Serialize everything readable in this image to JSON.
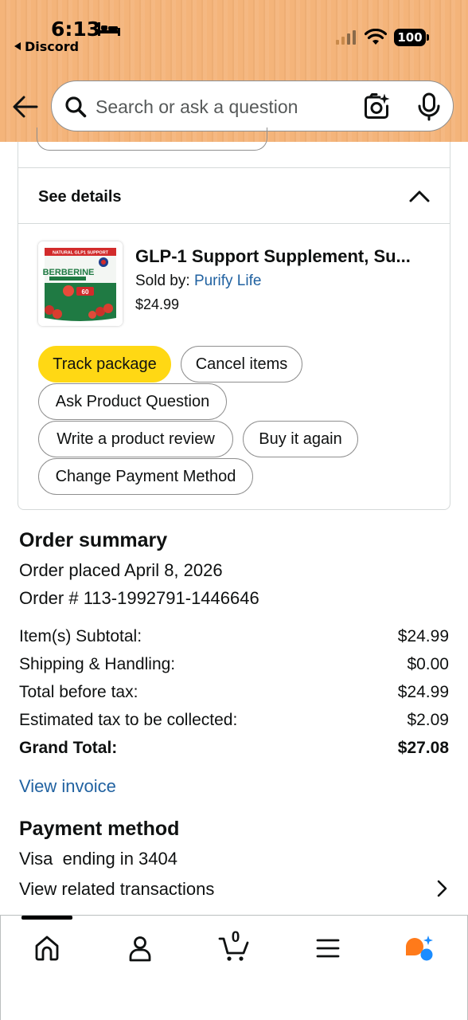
{
  "status_bar": {
    "time": "6:13",
    "back_app": "Discord",
    "battery": "100"
  },
  "search": {
    "placeholder": "Search or ask a question"
  },
  "colors": {
    "header_bg": "#f4b47a",
    "link": "#2162a1",
    "primary_button": "#ffd814",
    "ai_orange": "#ff7a1a",
    "ai_blue": "#1b8cff"
  },
  "details": {
    "label": "See details"
  },
  "product": {
    "title": "GLP-1 Support Supplement, Su...",
    "sold_by_label": "Sold by:",
    "seller": "Purify Life",
    "price": "$24.99",
    "image_text": {
      "top_banner": "NATURAL GLP1 SUPPORT",
      "brand": "BERBERINE",
      "count": "60"
    }
  },
  "actions": {
    "track": "Track package",
    "cancel": "Cancel items",
    "ask": "Ask Product Question",
    "review": "Write a product review",
    "buy_again": "Buy it again",
    "change_payment": "Change Payment Method"
  },
  "summary": {
    "heading": "Order summary",
    "placed": "Order placed April 8, 2026",
    "order_number": "Order # 113-1992791-1446646",
    "rows": [
      {
        "label": "Item(s) Subtotal:",
        "amount": "$24.99"
      },
      {
        "label": "Shipping & Handling:",
        "amount": "$0.00"
      },
      {
        "label": "Total before tax:",
        "amount": "$24.99"
      },
      {
        "label": "Estimated tax to be collected:",
        "amount": "$2.09"
      },
      {
        "label": "Grand Total:",
        "amount": "$27.08"
      }
    ],
    "view_invoice": "View invoice"
  },
  "payment": {
    "heading": "Payment method",
    "card": "Visa  ending in 3404",
    "related": "View related transactions"
  },
  "nav": {
    "cart_count": "0",
    "items": [
      "home-icon",
      "account-icon",
      "cart-icon",
      "menu-icon",
      "rufus-ai-icon"
    ]
  }
}
